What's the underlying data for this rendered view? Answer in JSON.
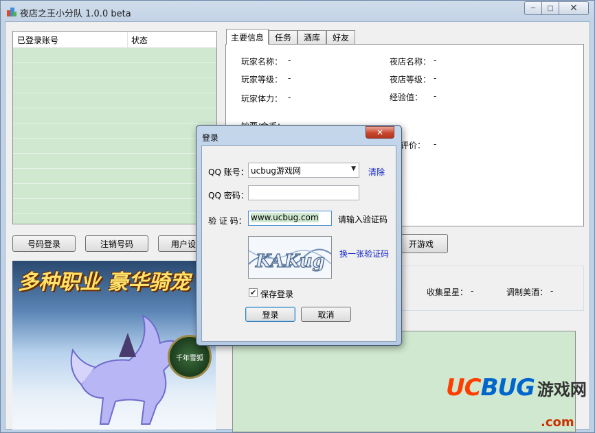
{
  "window": {
    "title": "夜店之王小分队 1.0.0 beta",
    "controls": {
      "minimize": "─",
      "maximize": "□",
      "close": "✕"
    }
  },
  "account_list": {
    "columns": [
      "已登录账号",
      "状态"
    ],
    "rows": []
  },
  "buttons": {
    "number_login": "号码登录",
    "logout_number": "注销号码",
    "user_settings": "用户设",
    "open_game": "开游戏"
  },
  "banner": {
    "headline": "多种职业 豪华骑宠",
    "badge": "千年雪狐"
  },
  "tabs": [
    "主要信息",
    "任务",
    "酒库",
    "好友"
  ],
  "main_info": {
    "player_name": "玩家名称：",
    "player_name_value": "-",
    "player_level": "玩家等级：",
    "player_level_value": "-",
    "player_stamina": "玩家体力：",
    "player_stamina_value": "-",
    "club_name": "夜店名称：",
    "club_name_value": "-",
    "club_level": "夜店等级：",
    "club_level_value": "-",
    "experience": "经验值：",
    "experience_value": "-",
    "coupons_gold": "钞票/金币：",
    "coupons_gold_value": "-",
    "rating_partial": "评价：",
    "rating_value": "-"
  },
  "stats": {
    "collect_stars": "收集星星：",
    "collect_stars_value": "-",
    "mix_wine": "调制美酒：",
    "mix_wine_value": "-"
  },
  "watermark": {
    "logo_uc": "UC",
    "logo_bug": "BUG",
    "cn": "游戏网",
    "com": ".com"
  },
  "login_dialog": {
    "title": "登录",
    "close": "✕",
    "qq_account_label": "QQ 账号：",
    "qq_account_value": "ucbug游戏网",
    "clear_link": "清除",
    "qq_password_label": "QQ 密码：",
    "qq_password_value": "",
    "captcha_label": "验 证 码：",
    "captcha_value": "www.ucbug.com",
    "captcha_hint": "请输入验证码",
    "captcha_text": "KAKug",
    "refresh_captcha_link": "换一张验证码",
    "save_login_label": "保存登录",
    "save_login_checked": true,
    "login_button": "登录",
    "cancel_button": "取消"
  }
}
